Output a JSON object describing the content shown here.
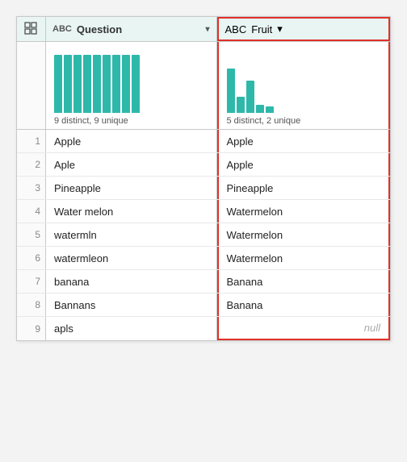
{
  "header": {
    "grid_icon": "⊞",
    "question_col": {
      "icon": "ABC",
      "label": "Question",
      "arrow": "▾"
    },
    "fruit_col": {
      "icon": "ABC",
      "label": "Fruit",
      "arrow": "▾"
    }
  },
  "chart": {
    "question": {
      "label": "9 distinct, 9 unique",
      "bars": [
        72,
        72,
        72,
        72,
        72,
        72,
        72,
        72,
        72
      ]
    },
    "fruit": {
      "label": "5 distinct, 2 unique",
      "bars": [
        55,
        20,
        40,
        10,
        8
      ]
    }
  },
  "rows": [
    {
      "num": "1",
      "question": "Apple",
      "fruit": "Apple"
    },
    {
      "num": "2",
      "question": "Aple",
      "fruit": "Apple"
    },
    {
      "num": "3",
      "question": "Pineapple",
      "fruit": "Pineapple"
    },
    {
      "num": "4",
      "question": "Water melon",
      "fruit": "Watermelon"
    },
    {
      "num": "5",
      "question": "watermln",
      "fruit": "Watermelon"
    },
    {
      "num": "6",
      "question": "watermleon",
      "fruit": "Watermelon"
    },
    {
      "num": "7",
      "question": "banana",
      "fruit": "Banana"
    },
    {
      "num": "8",
      "question": "Bannans",
      "fruit": "Banana"
    },
    {
      "num": "9",
      "question": "apls",
      "fruit": null
    }
  ]
}
